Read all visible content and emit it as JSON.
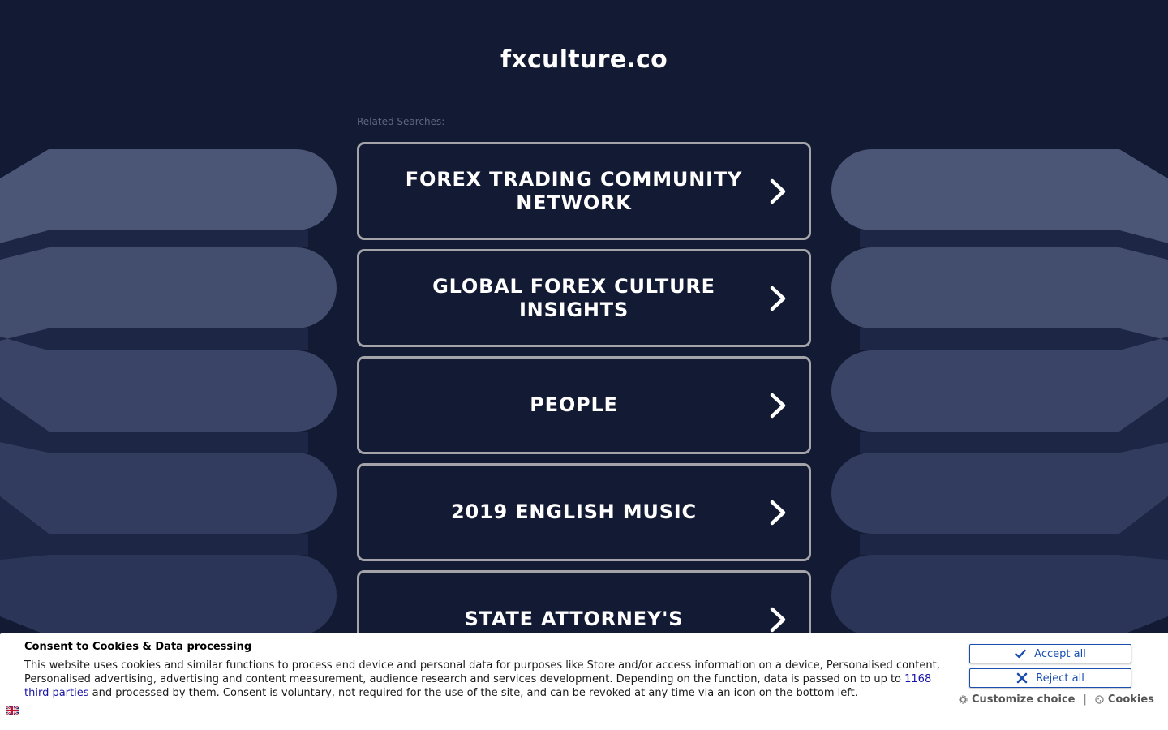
{
  "header": {
    "title": "fxculture.co"
  },
  "related": {
    "label": "Related Searches:",
    "items": [
      {
        "label": "FOREX TRADING COMMUNITY NETWORK"
      },
      {
        "label": "GLOBAL FOREX CULTURE INSIGHTS"
      },
      {
        "label": "PEOPLE"
      },
      {
        "label": "2019 ENGLISH MUSIC"
      },
      {
        "label": "STATE ATTORNEY'S"
      }
    ]
  },
  "consent": {
    "title": "Consent to Cookies & Data processing",
    "text_before_link": "This website uses cookies and similar functions to process end device and personal data for purposes like Store and/or access information on a device, Personalised content, Personalised advertising, advertising and content measurement, audience research and services development. Depending on the function, data is passed on to up to ",
    "link_text": "1168 third parties",
    "text_after_link": " and processed by them. Consent is voluntary, not required for the use of the site, and can be revoked at any time via an icon on the bottom left.",
    "accept_label": "Accept all",
    "reject_label": "Reject all",
    "customize_label": "Customize choice",
    "separator": "|",
    "cookies_label": "Cookies",
    "language_flag": "uk-flag-icon"
  },
  "colors": {
    "background": "#131a33",
    "shape_light": "#4b5575",
    "shape_mid": "#2c3658",
    "card_border": "#a3a3a8",
    "button_blue": "#1a4fb0"
  }
}
